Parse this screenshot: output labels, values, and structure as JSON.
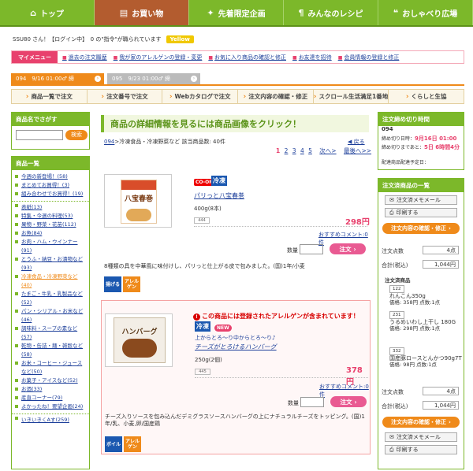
{
  "topnav": [
    {
      "label": "トップ",
      "icon": "⌂"
    },
    {
      "label": "お買い物",
      "icon": "▤"
    },
    {
      "label": "先着限定企画",
      "icon": "✦"
    },
    {
      "label": "みんなのレシピ",
      "icon": "¶"
    },
    {
      "label": "おしゃべり広場",
      "icon": "❝"
    }
  ],
  "user": {
    "text": "SSU80 さん！【ログイン中】　0 の\"指令\"が職られています",
    "yellow": "Yellow"
  },
  "mymenu": {
    "label": "マイメニュー",
    "items": [
      "過去の注文履歴",
      "我が家のアレルゲンの登録・変更",
      "お気に入り商品の確認と修正",
      "お友達を招待",
      "会員情報の登録と修正"
    ]
  },
  "tabs": [
    {
      "label": "094　9/16 01:00♂ 締"
    },
    {
      "label": "095　9/23 01:00♂ 締"
    }
  ],
  "subnav": [
    "商品一覧で注文",
    "注文番号で注文",
    "Webカタログで注文",
    "注文内容の確認・修正",
    "スクロール生活満足1番地",
    "くらしと生協"
  ],
  "search": {
    "title": "商品名でさがす",
    "button": "検索"
  },
  "categories": {
    "title": "商品一覧",
    "featured": [
      "今週の新登場！(58)",
      "まとめてお買得！(3)",
      "組み合わせでお買得！(19)"
    ],
    "items": [
      "表紙(13)",
      "特集・今週の料理(53)",
      "果物・野菜・花苗(112)",
      "お魚(84)",
      "お肉・ハム・ウインナー(91)",
      "とうふ・納豆・お漬物など(93)",
      "冷凍食品・冷凍野菜など(40)",
      "たまご・牛乳・乳製品など(52)",
      "パン・シリアル・お米など(46)",
      "調味料・スープの素など(57)",
      "乾物・缶詰・麺・雑穀など(58)",
      "お米・コーヒー・ジュースなど(50)",
      "お菓子・アイスなど(52)",
      "お酒(33)",
      "産直コーナー(79)",
      "よかったね！要望企画(24)"
    ],
    "last": "いきいきくAす(259)"
  },
  "headline": "商品の詳細情報を見るには商品画像をクリック！",
  "crumb": {
    "link": "094",
    "text": ">冷凍食品・冷凍野菜など 該当商品数: 40件",
    "back": "◀ 戻る"
  },
  "pager": {
    "current": "1",
    "pages": [
      "2",
      "3",
      "4",
      "5"
    ],
    "next": "次へ>",
    "last": "最後へ>>"
  },
  "products": [
    {
      "tags": {
        "coop": "CO-OP",
        "cold": "冷凍"
      },
      "name": "パリっと八宝春巻",
      "size": "400g(8本)",
      "code": "444",
      "price": "298円",
      "comment": "おすすめコメント:0件",
      "qty_label": "数量",
      "cart": "注文",
      "desc": "8種類の具を中華風に味付けし、パリっと仕上がる皮で包みました。(国)1年/小麦",
      "thumb_label": "八宝春巻",
      "badges": [
        "揚げる",
        "アレルゲン"
      ]
    },
    {
      "warning": "この商品には登録されたアレルゲンが含まれています！",
      "tags": {
        "cold": "冷凍",
        "new": "NEW"
      },
      "catch": "上からとろ〜り中からとろ〜り♪",
      "name": "チーズがとろけるハンバーグ",
      "size": "250g(2個)",
      "code": "445",
      "price": "378円",
      "comment": "おすすめコメント:0件",
      "qty_label": "数量",
      "cart": "注文",
      "desc": "チーズ入りソースを包み込んだデミグラスソースハンバーグの上にナチュラルチーズをトッピング。(国)1年/乳、小麦,卵/国産鶏",
      "thumb_label": "ハンバーグ",
      "badges": [
        "ボイル",
        "アレルゲン"
      ]
    }
  ],
  "deadline": {
    "title": "注文締め切り時間",
    "num": "094",
    "line1_label": "締め切り日時：",
    "line1_val": "9月16日 01:00",
    "line2_label": "締め切りまであと：",
    "line2_val": "5日 6時間4分",
    "line3": "配達商品配達予定日："
  },
  "cart": {
    "title": "注文済商品の一覧",
    "memo": "注文済メモメール",
    "print": "印刷する",
    "confirm": "注文内容の確認・修正",
    "count_label": "注文点数",
    "count": "4点",
    "total_label": "合計(税込)",
    "total": "1,044円",
    "list_title": "注文済商品",
    "items": [
      {
        "code": "122",
        "name": "れんこん350g",
        "price": "価格: 358円",
        "points": "点数:1点"
      },
      {
        "code": "231",
        "name": "うるめいわし上干し 180G",
        "price": "価格: 298円",
        "points": "点数:1点"
      },
      {
        "code": "332",
        "name": "国産豚ロースとんかつ90g7T",
        "price": "価格: 98円",
        "points": "点数:1点"
      }
    ]
  },
  "colors": {
    "green": "#7cb82a",
    "orange": "#ef8a1a",
    "pink": "#e8416d",
    "brown": "#b35c2f"
  }
}
